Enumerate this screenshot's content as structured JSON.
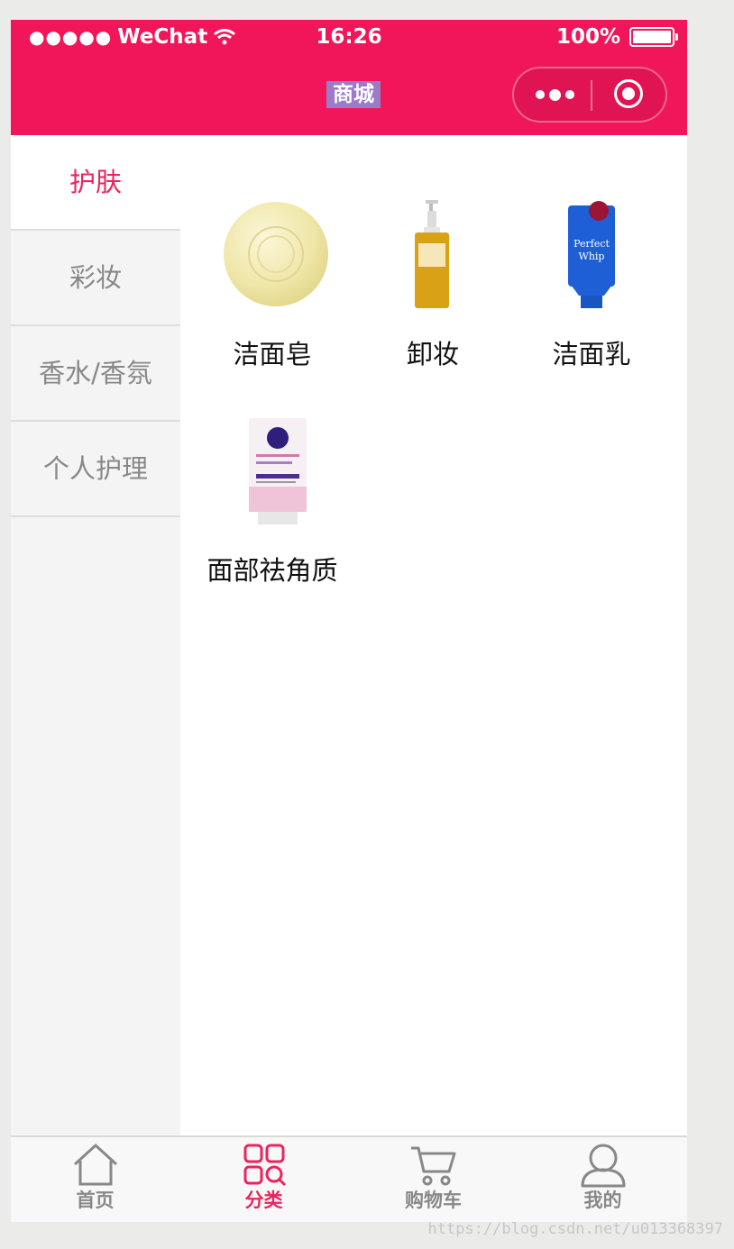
{
  "status_bar": {
    "carrier": "WeChat",
    "time": "16:26",
    "battery": "100%"
  },
  "nav": {
    "title": "商城"
  },
  "categories": [
    {
      "label": "护肤",
      "active": true
    },
    {
      "label": "彩妆",
      "active": false
    },
    {
      "label": "香水/香氛",
      "active": false
    },
    {
      "label": "个人护理",
      "active": false
    }
  ],
  "products": [
    {
      "name": "洁面皂",
      "icon": "soap-image"
    },
    {
      "name": "卸妆",
      "icon": "cleansing-oil-image"
    },
    {
      "name": "洁面乳",
      "icon": "perfect-whip-image"
    },
    {
      "name": "面部祛角质",
      "icon": "nivea-tube-image"
    }
  ],
  "tabs": [
    {
      "label": "首页",
      "icon": "home-icon",
      "active": false
    },
    {
      "label": "分类",
      "icon": "category-icon",
      "active": true
    },
    {
      "label": "购物车",
      "icon": "cart-icon",
      "active": false
    },
    {
      "label": "我的",
      "icon": "user-icon",
      "active": false
    }
  ],
  "watermark": "https://blog.csdn.net/u013368397",
  "colors": {
    "brand": "#f01659",
    "accent": "#e9245e",
    "sidebar_bg": "#f4f4f4",
    "inactive_text": "#888888"
  }
}
